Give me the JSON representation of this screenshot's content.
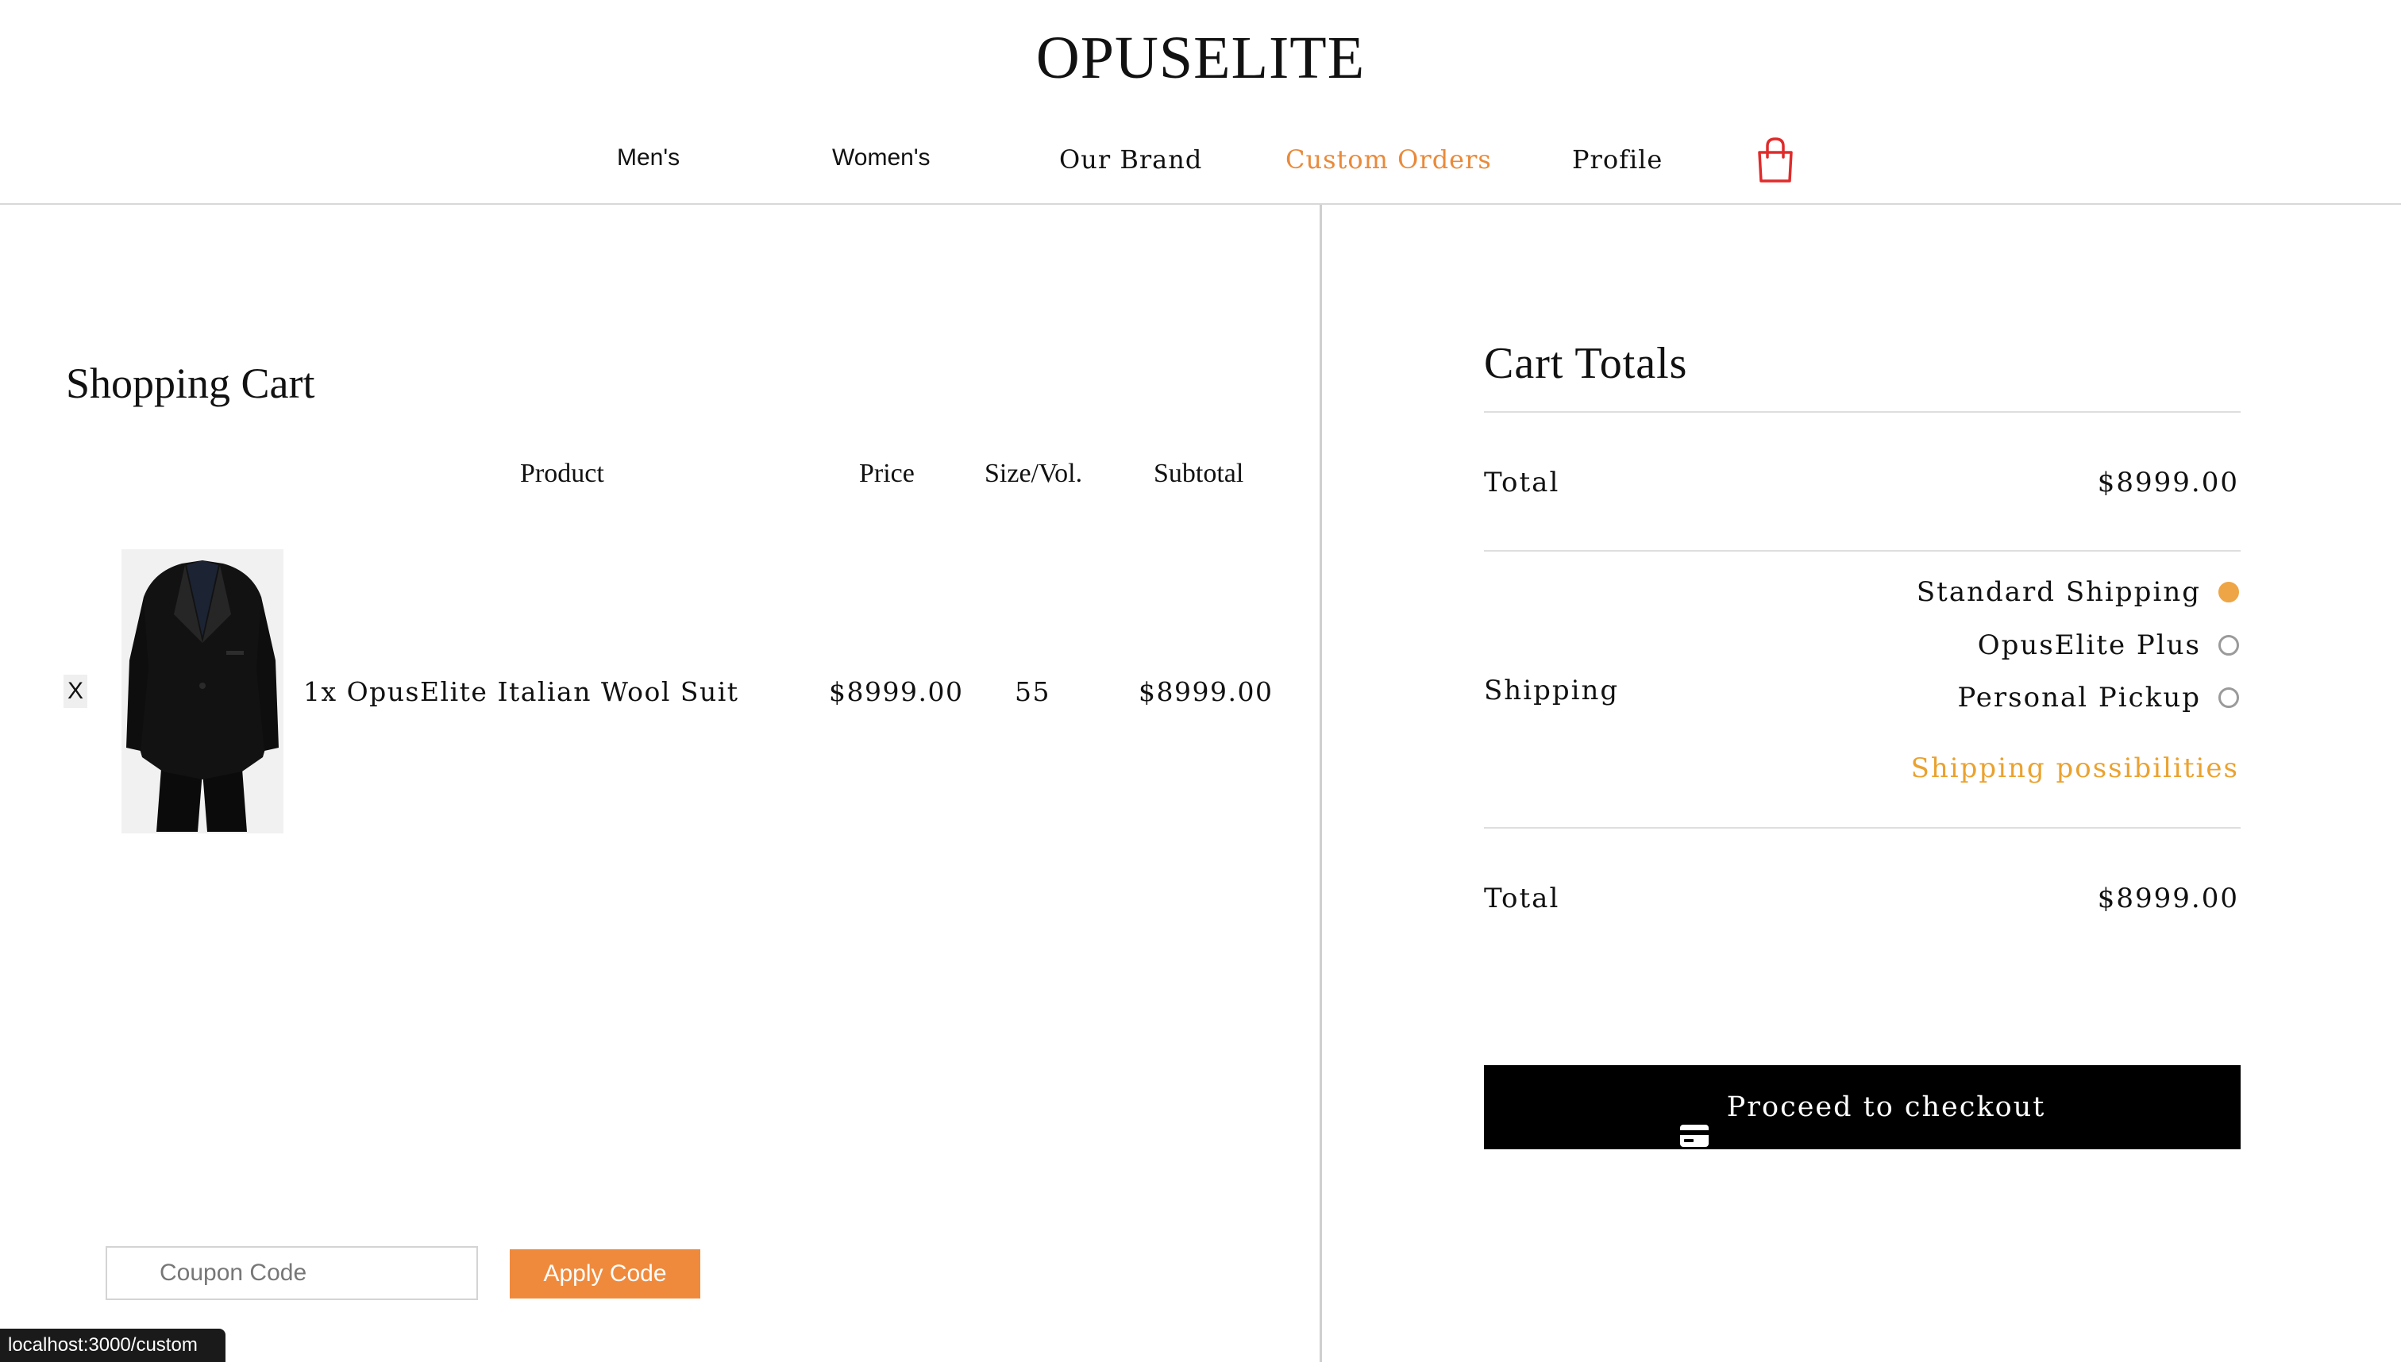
{
  "header": {
    "brand": "OPUSELITE",
    "nav": {
      "mens": "Men's",
      "womens": "Women's",
      "our_brand": "Our Brand",
      "custom_orders": "Custom Orders",
      "profile": "Profile"
    },
    "cart_icon": "shopping-bag-icon",
    "active_color": "#e98a3a",
    "cart_icon_color": "#e02b2b"
  },
  "cart": {
    "title": "Shopping Cart",
    "columns": {
      "product": "Product",
      "price": "Price",
      "size": "Size/Vol.",
      "subtotal": "Subtotal"
    },
    "items": [
      {
        "remove": "X",
        "name": "1x OpusElite Italian Wool Suit",
        "price": "$8999.00",
        "size": "55",
        "subtotal": "$8999.00"
      }
    ],
    "coupon": {
      "placeholder": "Coupon Code",
      "value": "",
      "apply_label": "Apply Code",
      "apply_color": "#ef8a3d"
    }
  },
  "totals": {
    "title": "Cart Totals",
    "total_label": "Total",
    "total_value": "$8999.00",
    "shipping_label": "Shipping",
    "shipping_options": [
      {
        "label": "Standard Shipping",
        "selected": true
      },
      {
        "label": "OpusElite Plus",
        "selected": false
      },
      {
        "label": "Personal Pickup",
        "selected": false
      }
    ],
    "shipping_link": "Shipping possibilities",
    "grand_total_label": "Total",
    "grand_total_value": "$8999.00",
    "checkout_label": "Proceed to checkout",
    "checkout_icon": "credit-card-icon",
    "radio_selected_color": "#eea545",
    "link_color": "#eaa22f"
  },
  "status_bar": {
    "url": "localhost:3000/custom"
  }
}
